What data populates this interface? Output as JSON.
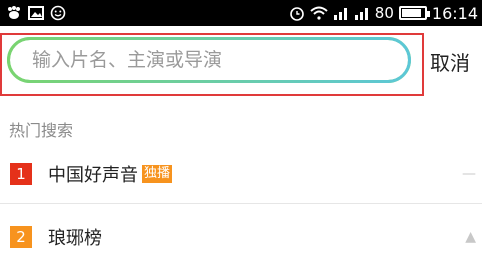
{
  "status_bar": {
    "left_icons": [
      "paw-icon",
      "image-icon",
      "smiley-icon"
    ],
    "right_icons": [
      "alarm-icon",
      "wifi-icon",
      "signal-icon",
      "signal-icon-2",
      "battery-icon"
    ],
    "battery_level": "80",
    "time": "16:14"
  },
  "search": {
    "placeholder": "输入片名、主演或导演",
    "value": "",
    "cancel_label": "取消"
  },
  "hot": {
    "title": "热门搜索",
    "items": [
      {
        "rank": "1",
        "title": "中国好声音",
        "badge": "独播"
      },
      {
        "rank": "2",
        "title": "琅琊榜",
        "badge": ""
      }
    ]
  }
}
